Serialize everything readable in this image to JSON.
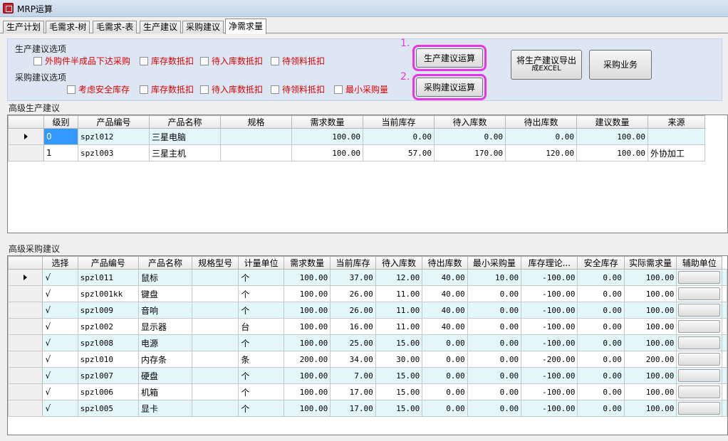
{
  "window": {
    "title": "MRP运算"
  },
  "tabs": [
    {
      "label": "生产计划"
    },
    {
      "label": "毛需求-树"
    },
    {
      "label": "毛需求-表"
    },
    {
      "label": "生产建议"
    },
    {
      "label": "采购建议"
    },
    {
      "label": "净需求量"
    }
  ],
  "active_tab": 5,
  "options": {
    "production_title": "生产建议选项",
    "production_checks": [
      "外购件半成品下达采购",
      "库存数抵扣",
      "待入库数抵扣",
      "待领料抵扣"
    ],
    "purchase_title": "采购建议选项",
    "purchase_checks": [
      "考虑安全库存",
      "库存数抵扣",
      "待入库数抵扣",
      "待领料抵扣",
      "最小采购量"
    ],
    "step1": "1.",
    "step2": "2.",
    "btn_production_calc": "生产建议运算",
    "btn_purchase_calc": "采购建议运算",
    "btn_export_line1": "将生产建议导出",
    "btn_export_line2": "成EXCEL",
    "btn_purchase_biz": "采购业务"
  },
  "production_grid": {
    "title": "高级生产建议",
    "columns": [
      "级别",
      "产品编号",
      "产品名称",
      "规格",
      "需求数量",
      "当前库存",
      "待入库数",
      "待出库数",
      "建议数量",
      "来源"
    ],
    "rows": [
      [
        "0",
        "spzl012",
        "三星电脑",
        "",
        "100.00",
        "0.00",
        "0.00",
        "0.00",
        "100.00",
        ""
      ],
      [
        "1",
        "spzl003",
        "三星主机",
        "",
        "100.00",
        "57.00",
        "170.00",
        "120.00",
        "100.00",
        "外协加工"
      ]
    ]
  },
  "purchase_grid": {
    "title": "高级采购建议",
    "columns": [
      "选择",
      "产品编号",
      "产品名称",
      "规格型号",
      "计量单位",
      "需求数量",
      "当前库存",
      "待入库数",
      "待出库数",
      "最小采购量",
      "库存理论...",
      "安全库存",
      "实际需求量",
      "辅助单位"
    ],
    "check": "√",
    "rows": [
      [
        "spzl011",
        "鼠标",
        "",
        "个",
        "100.00",
        "37.00",
        "12.00",
        "40.00",
        "10.00",
        "-100.00",
        "0.00",
        "100.00"
      ],
      [
        "spzl001kk",
        "键盘",
        "",
        "个",
        "100.00",
        "26.00",
        "11.00",
        "40.00",
        "0.00",
        "-100.00",
        "0.00",
        "100.00"
      ],
      [
        "spzl009",
        "音响",
        "",
        "个",
        "100.00",
        "26.00",
        "11.00",
        "40.00",
        "0.00",
        "-100.00",
        "0.00",
        "100.00"
      ],
      [
        "spzl002",
        "显示器",
        "",
        "台",
        "100.00",
        "16.00",
        "11.00",
        "40.00",
        "0.00",
        "-100.00",
        "0.00",
        "100.00"
      ],
      [
        "spzl008",
        "电源",
        "",
        "个",
        "100.00",
        "25.00",
        "15.00",
        "0.00",
        "0.00",
        "-100.00",
        "0.00",
        "100.00"
      ],
      [
        "spzl010",
        "内存条",
        "",
        "条",
        "200.00",
        "34.00",
        "30.00",
        "0.00",
        "0.00",
        "-200.00",
        "0.00",
        "200.00"
      ],
      [
        "spzl007",
        "硬盘",
        "",
        "个",
        "100.00",
        "7.00",
        "15.00",
        "0.00",
        "0.00",
        "-100.00",
        "0.00",
        "100.00"
      ],
      [
        "spzl006",
        "机箱",
        "",
        "个",
        "100.00",
        "17.00",
        "15.00",
        "0.00",
        "0.00",
        "-100.00",
        "0.00",
        "100.00"
      ],
      [
        "spzl005",
        "显卡",
        "",
        "个",
        "100.00",
        "17.00",
        "15.00",
        "0.00",
        "0.00",
        "-100.00",
        "0.00",
        "100.00"
      ]
    ]
  }
}
